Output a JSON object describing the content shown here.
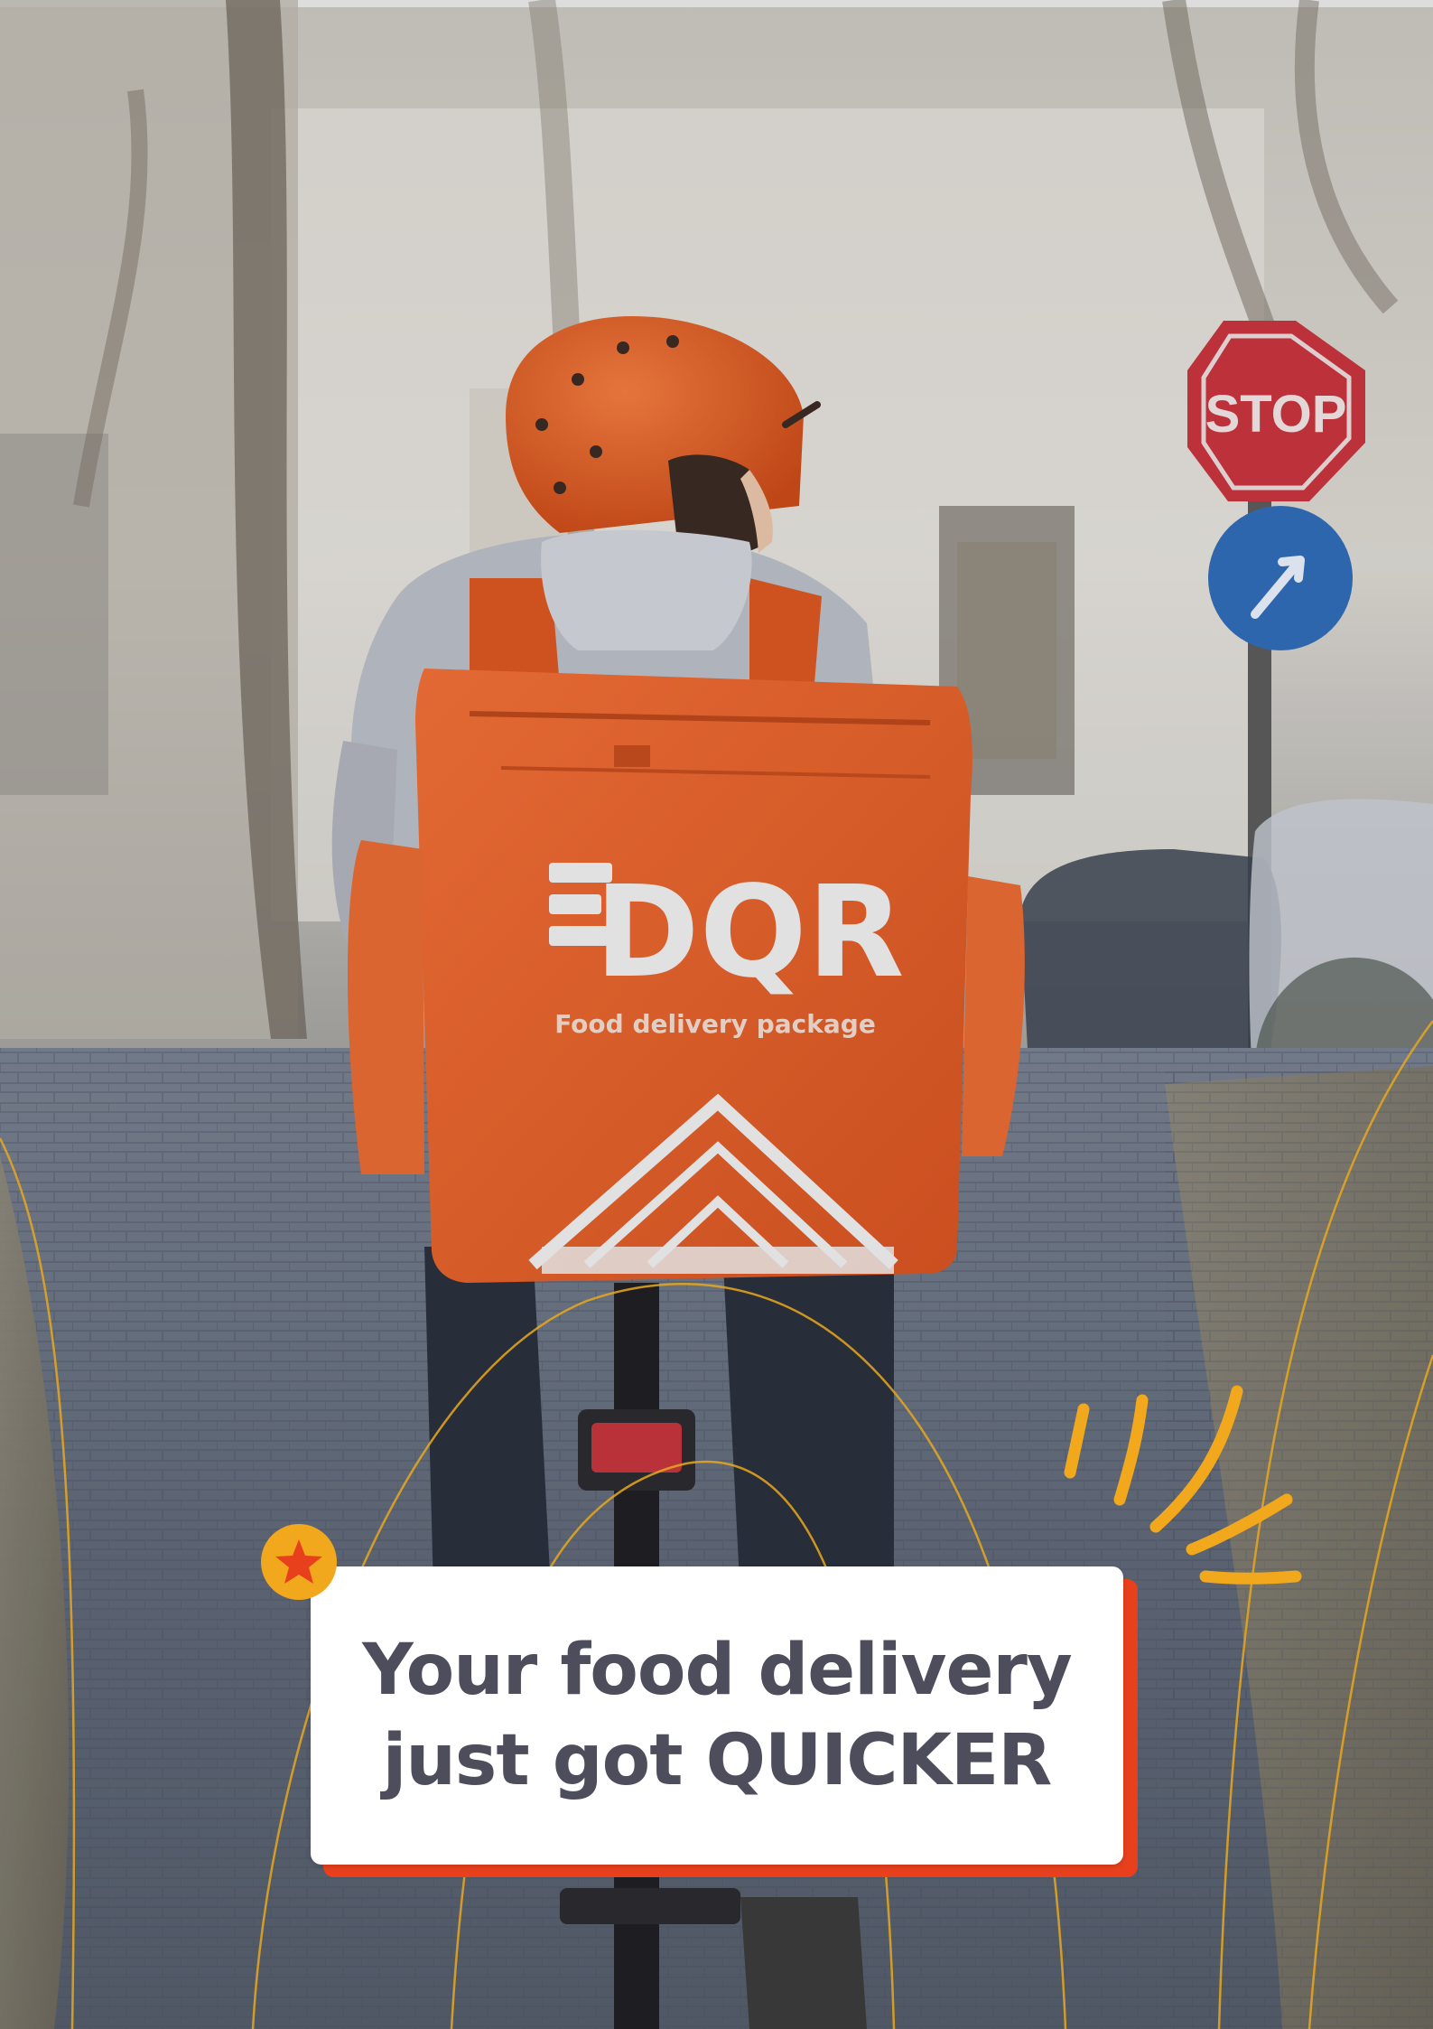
{
  "bag": {
    "logo_text": "DQR",
    "subtitle": "Food delivery package"
  },
  "sign": {
    "stop_text": "STOP"
  },
  "caption": {
    "line1": "Your food delivery",
    "line2": "just got QUICKER"
  },
  "colors": {
    "accent_orange": "#e8622c",
    "caption_shadow": "#e8401c",
    "badge_yellow": "#f2a81d",
    "star_red": "#e8401c",
    "caption_text": "#4d4d5c",
    "gold_lines": "#e8a81d"
  },
  "icons": {
    "badge": "star-icon",
    "decoration": "spark-lines-icon"
  }
}
